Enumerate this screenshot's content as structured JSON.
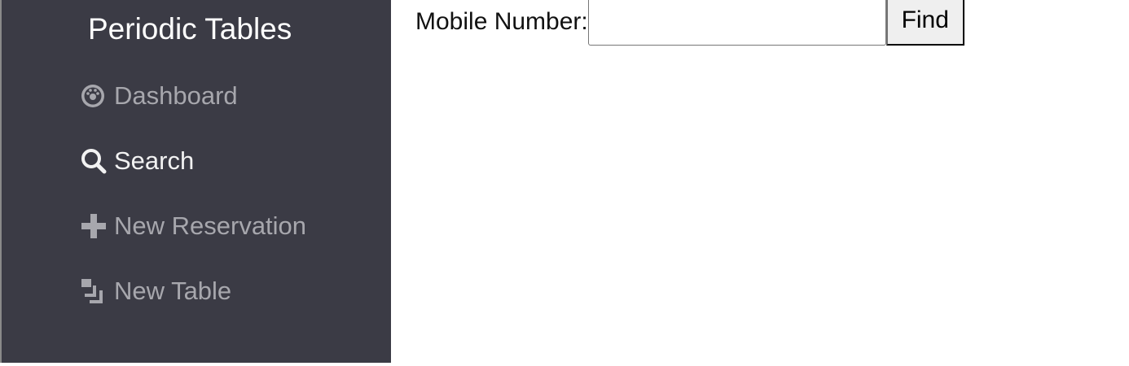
{
  "sidebar": {
    "brand": "Periodic Tables",
    "items": [
      {
        "label": "Dashboard",
        "icon": "dashboard-icon",
        "active": false
      },
      {
        "label": "Search",
        "icon": "search-icon",
        "active": true
      },
      {
        "label": "New Reservation",
        "icon": "plus-icon",
        "active": false
      },
      {
        "label": "New Table",
        "icon": "layers-icon",
        "active": false
      }
    ],
    "colors": {
      "background": "#3b3b45",
      "active_text": "#f2f2f2",
      "inactive_text": "#a7a7ad"
    }
  },
  "search_form": {
    "mobile_label": "Mobile Number:",
    "mobile_value": "",
    "mobile_placeholder": "",
    "find_label": "Find"
  }
}
